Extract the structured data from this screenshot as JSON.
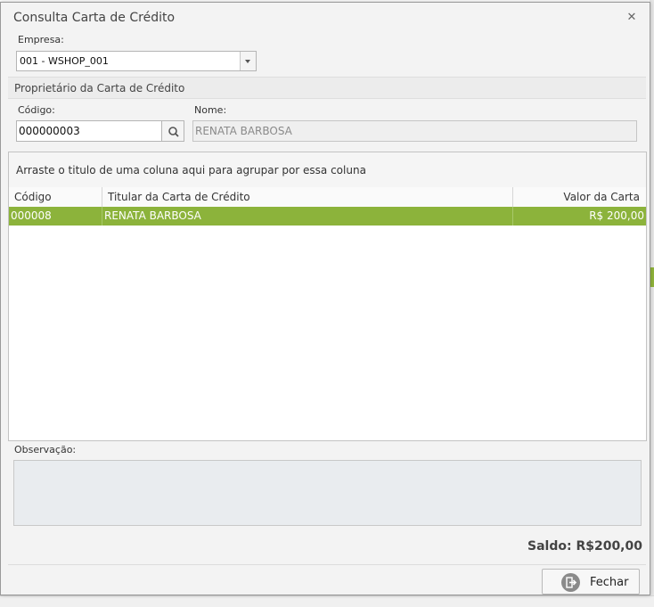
{
  "window": {
    "title": "Consulta Carta de Crédito",
    "close_glyph": "✕"
  },
  "empresa": {
    "label": "Empresa:",
    "value": "001 - WSHOP_001"
  },
  "owner_group": {
    "title": "Proprietário da Carta de Crédito",
    "codigo_label": "Código:",
    "codigo_value": "000000003",
    "nome_label": "Nome:",
    "nome_value": "RENATA BARBOSA"
  },
  "grid": {
    "group_hint": "Arraste o titulo de uma coluna aqui para agrupar por essa coluna",
    "columns": [
      "Código",
      "Titular da Carta de Crédito",
      "Valor da Carta"
    ],
    "rows": [
      {
        "codigo": "000008",
        "titular": "RENATA BARBOSA",
        "valor": "R$ 200,00"
      }
    ]
  },
  "observacao": {
    "label": "Observação:"
  },
  "saldo": {
    "text": "Saldo: R$200,00"
  },
  "buttons": {
    "fechar": "Fechar"
  },
  "icons": {
    "close": "close-icon",
    "search": "search-icon",
    "dropdown": "chevron-down-icon",
    "exit": "exit-icon"
  },
  "colors": {
    "selected_row": "#8cb33b",
    "dialog_bg": "#f3f3f3"
  }
}
